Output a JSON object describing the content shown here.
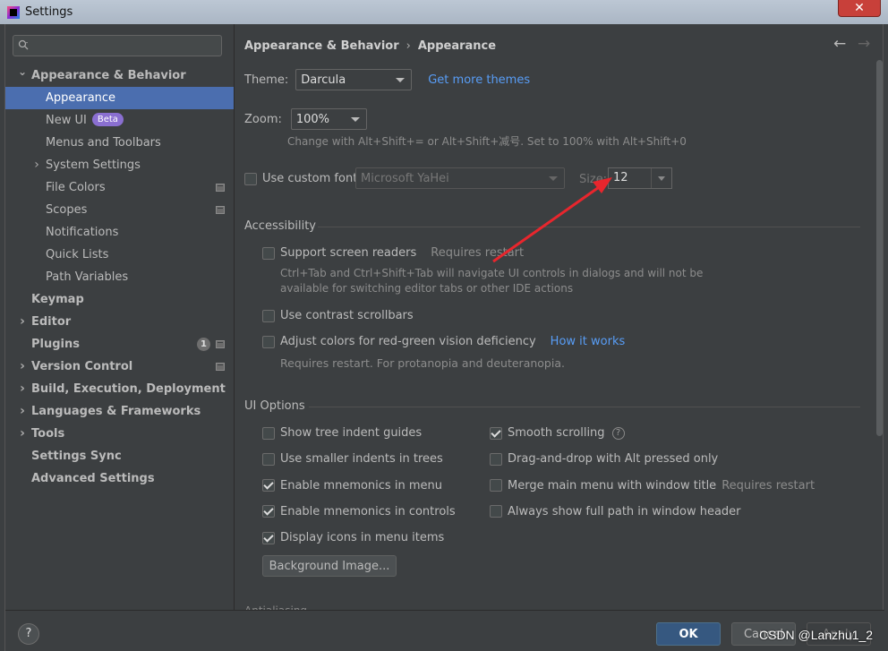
{
  "window": {
    "title": "Settings",
    "close_label": "✕"
  },
  "sidebar": {
    "search_placeholder": "",
    "items": [
      {
        "label": "Appearance & Behavior",
        "level": 0,
        "bold": true,
        "expanded": true
      },
      {
        "label": "Appearance",
        "level": 1,
        "selected": true
      },
      {
        "label": "New UI",
        "level": 1,
        "badge": "Beta"
      },
      {
        "label": "Menus and Toolbars",
        "level": 1
      },
      {
        "label": "System Settings",
        "level": 1,
        "collapsed": true
      },
      {
        "label": "File Colors",
        "level": 1,
        "proj": true
      },
      {
        "label": "Scopes",
        "level": 1,
        "proj": true
      },
      {
        "label": "Notifications",
        "level": 1
      },
      {
        "label": "Quick Lists",
        "level": 1
      },
      {
        "label": "Path Variables",
        "level": 1
      },
      {
        "label": "Keymap",
        "level": 0,
        "bold": true
      },
      {
        "label": "Editor",
        "level": 0,
        "bold": true,
        "collapsed": true
      },
      {
        "label": "Plugins",
        "level": 0,
        "bold": true,
        "count": "1",
        "proj": true
      },
      {
        "label": "Version Control",
        "level": 0,
        "bold": true,
        "collapsed": true,
        "proj": true
      },
      {
        "label": "Build, Execution, Deployment",
        "level": 0,
        "bold": true,
        "collapsed": true
      },
      {
        "label": "Languages & Frameworks",
        "level": 0,
        "bold": true,
        "collapsed": true
      },
      {
        "label": "Tools",
        "level": 0,
        "bold": true,
        "collapsed": true
      },
      {
        "label": "Settings Sync",
        "level": 0,
        "bold": true
      },
      {
        "label": "Advanced Settings",
        "level": 0,
        "bold": true
      }
    ]
  },
  "main": {
    "breadcrumb": [
      "Appearance & Behavior",
      "Appearance"
    ],
    "theme": {
      "label": "Theme:",
      "value": "Darcula",
      "link": "Get more themes"
    },
    "zoom": {
      "label": "Zoom:",
      "value": "100%",
      "hint": "Change with Alt+Shift+= or Alt+Shift+减号. Set to 100% with Alt+Shift+0"
    },
    "custom_font": {
      "label": "Use custom font:",
      "checked": false,
      "font_value": "Microsoft YaHei",
      "size_label": "Size:",
      "size_value": "12"
    },
    "accessibility": {
      "title": "Accessibility",
      "screen_readers_label": "Support screen readers",
      "screen_readers_hint": "Requires restart",
      "screen_readers_desc_1": "Ctrl+Tab and Ctrl+Shift+Tab will navigate UI controls in dialogs and will not be",
      "screen_readers_desc_2": "available for switching editor tabs or other IDE actions",
      "contrast_label": "Use contrast scrollbars",
      "color_label": "Adjust colors for red-green vision deficiency",
      "color_link": "How it works",
      "color_desc": "Requires restart. For protanopia and deuteranopia."
    },
    "ui_options": {
      "title": "UI Options",
      "left": [
        {
          "label": "Show tree indent guides",
          "checked": false
        },
        {
          "label": "Use smaller indents in trees",
          "checked": false
        },
        {
          "label": "Enable mnemonics in menu",
          "checked": true
        },
        {
          "label": "Enable mnemonics in controls",
          "checked": true
        },
        {
          "label": "Display icons in menu items",
          "checked": true
        }
      ],
      "right": [
        {
          "label": "Smooth scrolling",
          "checked": true,
          "help": "?"
        },
        {
          "label": "Drag-and-drop with Alt pressed only",
          "checked": false
        },
        {
          "label": "Merge main menu with window title",
          "checked": false,
          "hint": "Requires restart"
        },
        {
          "label": "Always show full path in window header",
          "checked": false
        }
      ],
      "background_button": "Background Image..."
    },
    "next_section_partial": "Antialiasing"
  },
  "footer": {
    "help": "?",
    "ok": "OK",
    "cancel": "Cancel",
    "apply": "Apply"
  },
  "watermark": "CSDN @Lanzhu1_2",
  "colors": {
    "selection": "#4b6eaf",
    "link": "#589df6",
    "ok_button": "#365880",
    "annotation_arrow": "#e8262d"
  }
}
